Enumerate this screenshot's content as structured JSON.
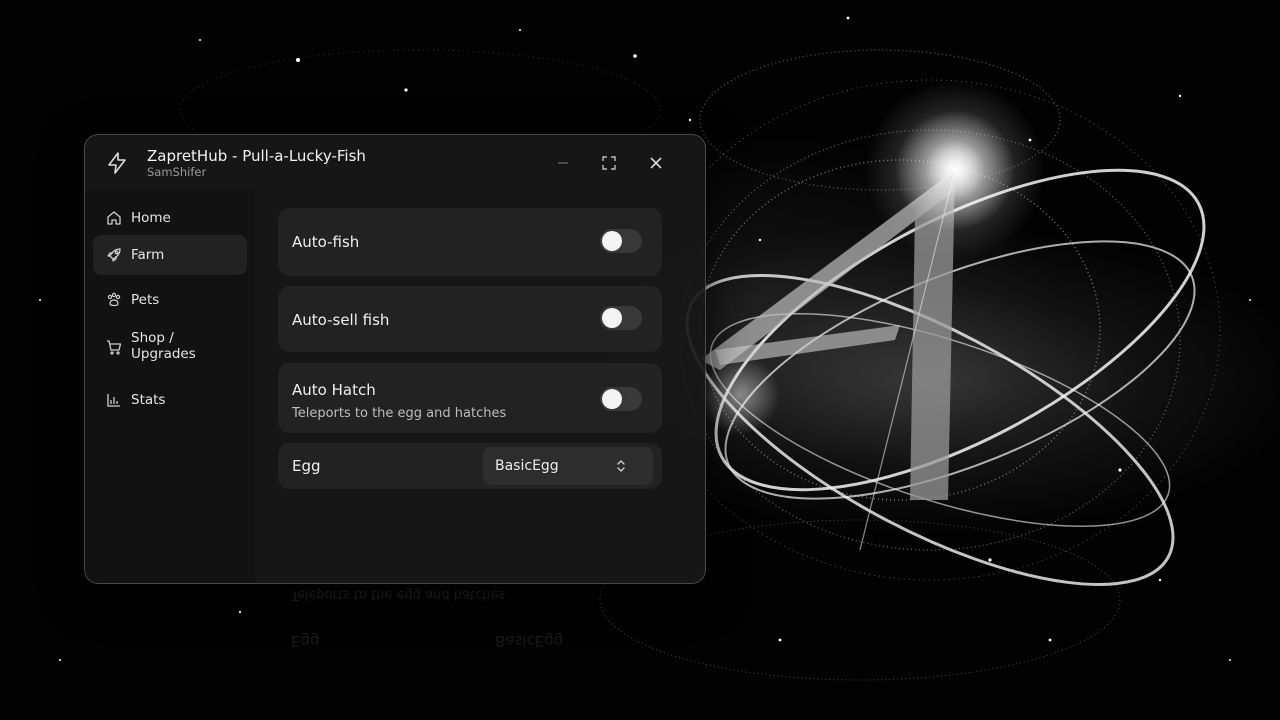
{
  "window": {
    "title": "ZapretHub - Pull-a-Lucky-Fish",
    "subtitle": "SamShifer",
    "app_icon": "lightning-icon",
    "controls": {
      "minimize": "minimize-icon",
      "maximize": "maximize-icon",
      "close": "close-icon"
    }
  },
  "sidebar": {
    "items": [
      {
        "label": "Home",
        "icon": "home-icon",
        "active": false
      },
      {
        "label": "Farm",
        "icon": "rocket-icon",
        "active": true
      },
      {
        "label": "Pets",
        "icon": "paw-icon",
        "active": false
      },
      {
        "label": "Shop /\nUpgrades",
        "icon": "cart-icon",
        "active": false
      },
      {
        "label": "Stats",
        "icon": "bar-chart-icon",
        "active": false
      }
    ]
  },
  "main": {
    "auto_fish": {
      "label": "Auto-fish",
      "enabled": false
    },
    "auto_sell": {
      "label": "Auto-sell fish",
      "enabled": false
    },
    "auto_hatch": {
      "label": "Auto Hatch",
      "description": "Teleports to the egg and hatches",
      "enabled": false
    },
    "egg": {
      "label": "Egg",
      "value": "BasicEgg",
      "icon": "chevron-up-down-icon"
    }
  },
  "colors": {
    "window_bg": "#181818",
    "card_bg": "#262626",
    "text": "#f0f0f0",
    "muted": "#9a9a9a",
    "toggle_knob": "#f4f4f4"
  }
}
